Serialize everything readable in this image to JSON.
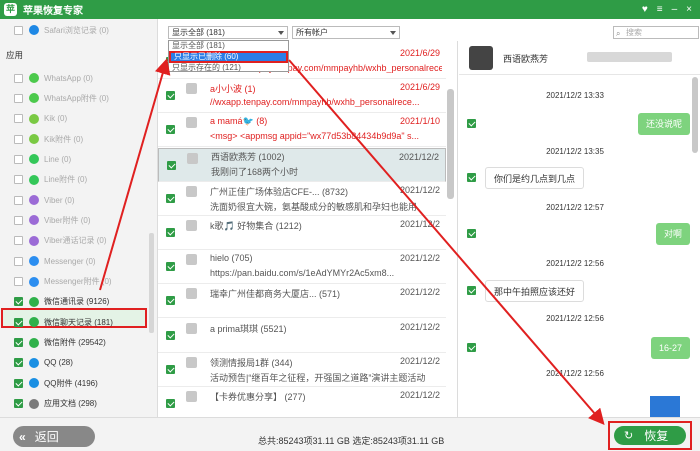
{
  "app": {
    "title": "苹果恢复专家",
    "logo": "苹"
  },
  "window_controls": [
    "♥",
    "≡",
    "–",
    "×"
  ],
  "sidebar": {
    "section_label": "应用",
    "top_item": {
      "label": "Safari浏览记录 (0)",
      "icon": "safari-icon",
      "color": "#1e88e5"
    },
    "items": [
      {
        "label": "WhatsApp (0)",
        "icon": "whatsapp-icon",
        "color": "#4cc94c",
        "checked": false,
        "dim": true
      },
      {
        "label": "WhatsApp附件 (0)",
        "icon": "whatsapp-icon",
        "color": "#4cc94c",
        "checked": false,
        "dim": true
      },
      {
        "label": "Kik (0)",
        "icon": "kik-icon",
        "color": "#7ac943",
        "checked": false,
        "dim": true
      },
      {
        "label": "Kik附件 (0)",
        "icon": "kik-icon",
        "color": "#7ac943",
        "checked": false,
        "dim": true
      },
      {
        "label": "Line (0)",
        "icon": "line-icon",
        "color": "#34c759",
        "checked": false,
        "dim": true
      },
      {
        "label": "Line附件 (0)",
        "icon": "line-icon",
        "color": "#34c759",
        "checked": false,
        "dim": true
      },
      {
        "label": "Viber (0)",
        "icon": "viber-icon",
        "color": "#9b6bd6",
        "checked": false,
        "dim": true
      },
      {
        "label": "Viber附件 (0)",
        "icon": "viber-icon",
        "color": "#9b6bd6",
        "checked": false,
        "dim": true
      },
      {
        "label": "Viber通话记录 (0)",
        "icon": "viber-icon",
        "color": "#9b6bd6",
        "checked": false,
        "dim": true
      },
      {
        "label": "Messenger (0)",
        "icon": "messenger-icon",
        "color": "#2c8ef0",
        "checked": false,
        "dim": true
      },
      {
        "label": "Messenger附件 (0)",
        "icon": "messenger-icon",
        "color": "#2c8ef0",
        "checked": false,
        "dim": true
      },
      {
        "label": "微信通讯录 (9126)",
        "icon": "wechat-icon",
        "color": "#2fb14a",
        "checked": true,
        "dim": false
      },
      {
        "label": "微信聊天记录 (181)",
        "icon": "wechat-icon",
        "color": "#2fb14a",
        "checked": true,
        "dim": false
      },
      {
        "label": "微信附件 (29542)",
        "icon": "wechat-icon",
        "color": "#2fb14a",
        "checked": true,
        "dim": false
      },
      {
        "label": "QQ (28)",
        "icon": "qq-icon",
        "color": "#1a8fe3",
        "checked": true,
        "dim": false
      },
      {
        "label": "QQ附件 (4196)",
        "icon": "qq-icon",
        "color": "#1a8fe3",
        "checked": true,
        "dim": false
      },
      {
        "label": "应用文档 (298)",
        "icon": "document-icon",
        "color": "#7a7a7a",
        "checked": true,
        "dim": false
      }
    ]
  },
  "toolbar": {
    "filter_value": "显示全部 (181)",
    "account_value": "所有帐户",
    "search_placeholder": "搜索"
  },
  "dropdown": {
    "options": [
      "显示全部 (181)",
      "只显示已删除 (60)",
      "只显示存在的 (121)"
    ],
    "selected_index": 1
  },
  "list": {
    "items": [
      {
        "name": "",
        "date": "2021/6/29",
        "preview": "<weixin://wxpay.tenpay.com/mmpayhb/wxhb_personalrece...",
        "deleted": true,
        "checked": true
      },
      {
        "name": "a小小波 (1)",
        "date": "2021/6/29",
        "preview": "//wxapp.tenpay.com/mmpayhb/wxhb_personalrece...",
        "deleted": true,
        "checked": true
      },
      {
        "name": "a mamá🐦 (8)",
        "date": "2021/1/10",
        "preview": "<msg> <appmsg appid=\"wx77d53b84434b9d9a\" s...",
        "deleted": true,
        "checked": true
      },
      {
        "name": "西语欧燕芳 (1002)",
        "date": "2021/12/2",
        "preview": "我刚问了168两个小时",
        "deleted": false,
        "checked": true,
        "selected": true
      },
      {
        "name": "广州正佳广场体验店CFE-... (8732)",
        "date": "2021/12/2",
        "preview": "洗面奶很宜大碗，氨基酸成分的敏感肌和孕妇也能用",
        "deleted": false,
        "checked": true
      },
      {
        "name": "k歌🎵 好物集合 (1212)",
        "date": "2021/12/2",
        "preview": "",
        "deleted": false,
        "checked": true
      },
      {
        "name": "hielo (705)",
        "date": "2021/12/2",
        "preview": "https://pan.baidu.com/s/1eAdYMYr2Ac5xm8...",
        "deleted": false,
        "checked": true
      },
      {
        "name": "瑞幸广州佳都商务大厦店... (571)",
        "date": "2021/12/2",
        "preview": "",
        "deleted": false,
        "checked": true
      },
      {
        "name": "a prima琪琪 (5521)",
        "date": "2021/12/2",
        "preview": "",
        "deleted": false,
        "checked": true
      },
      {
        "name": "领测情报局1群 (344)",
        "date": "2021/12/2",
        "preview": "活动预告|“继百年之征程，开强国之道路”演讲主题活动",
        "deleted": false,
        "checked": true
      },
      {
        "name": "【卡券优惠分享】 (277)",
        "date": "2021/12/2",
        "preview": "",
        "deleted": false,
        "checked": true
      }
    ]
  },
  "chat": {
    "contact_name": "西语欧燕芳",
    "messages": [
      {
        "type": "time",
        "text": "2021/12/2 13:33"
      },
      {
        "type": "right",
        "text": "还没说呢"
      },
      {
        "type": "time",
        "text": "2021/12/2 13:35"
      },
      {
        "type": "left",
        "text": "你们是约几点到几点"
      },
      {
        "type": "time",
        "text": "2021/12/2 12:57"
      },
      {
        "type": "right",
        "text": "对啊"
      },
      {
        "type": "time",
        "text": "2021/12/2 12:56"
      },
      {
        "type": "left",
        "text": "那中午拍照应该还好"
      },
      {
        "type": "time",
        "text": "2021/12/2 12:56"
      },
      {
        "type": "right",
        "text": "16-27"
      },
      {
        "type": "time",
        "text": "2021/12/2 12:56"
      }
    ]
  },
  "footer": {
    "back_label": "返回",
    "total_text": "总共:85243项31.11 GB 选定:85243项31.11 GB",
    "restore_label": "恢复"
  },
  "colors": {
    "brand_green": "#2f9c46",
    "deleted_red": "#e02020",
    "annotation_red": "#e02020",
    "bubble_green": "#7ed37e"
  }
}
